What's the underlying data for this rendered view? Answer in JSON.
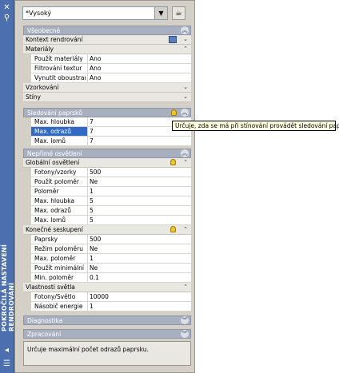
{
  "titlebar": {
    "title": "POKROČILÁ NASTAVENÍ RENDROVÁNÍ",
    "top_icon": "pin-icon",
    "bottom_icons": [
      "auto-hide-icon",
      "properties-icon"
    ]
  },
  "topbar": {
    "preset_value": "*Vysoký",
    "render_icon": "teapot-render-icon"
  },
  "sections": {
    "general": {
      "title": "Všeobecné",
      "render_context_label": "Kontext rendrování",
      "materials_label": "Materiály",
      "materials_rows": [
        {
          "name": "Použít materiály",
          "value": "Ano"
        },
        {
          "name": "Filtrování textur",
          "value": "Ano"
        },
        {
          "name": "Vynutit oboustrannou",
          "value": "Ano"
        }
      ],
      "sampling_label": "Vzorkování",
      "shadows_label": "Stíny"
    },
    "raytrace": {
      "title": "Sledování paprsků",
      "rows": [
        {
          "name": "Max. hloubka",
          "value": "7"
        },
        {
          "name": "Max. odrazů",
          "value": "7"
        },
        {
          "name": "Max. lomů",
          "value": "7"
        }
      ]
    },
    "indirect": {
      "title": "Nepřímé osvětlení",
      "global_label": "Globální osvětlení",
      "global_rows": [
        {
          "name": "Fotony/vzorky",
          "value": "500"
        },
        {
          "name": "Použít poloměr",
          "value": "Ne"
        },
        {
          "name": "Poloměr",
          "value": "1"
        },
        {
          "name": "Max. hloubka",
          "value": "5"
        },
        {
          "name": "Max. odrazů",
          "value": "5"
        },
        {
          "name": "Max. lomů",
          "value": "5"
        }
      ],
      "final_label": "Konečné seskupení",
      "final_rows": [
        {
          "name": "Paprsky",
          "value": "500"
        },
        {
          "name": "Režim poloměru",
          "value": "Ne"
        },
        {
          "name": "Max. poloměr",
          "value": "1"
        },
        {
          "name": "Použít minimální",
          "value": "Ne"
        },
        {
          "name": "Min. poloměr",
          "value": "0.1"
        }
      ],
      "light_label": "Vlastnosti světla",
      "light_rows": [
        {
          "name": "Fotony/Světlo",
          "value": "10000"
        },
        {
          "name": "Násobič energie",
          "value": "1"
        }
      ]
    },
    "diagnostics": {
      "title": "Diagnostika"
    },
    "processing": {
      "title": "Zpracování"
    }
  },
  "status_text": "Určuje maximální počet odrazů paprsku.",
  "tooltip": "Určuje, zda se má při stínování provádět sledování paprsků.",
  "colors": {
    "titlebar": "#4c6fb0",
    "section_header": "#a8b0c0",
    "selection": "#316ac5",
    "tooltip_bg": "#ffffe1"
  }
}
